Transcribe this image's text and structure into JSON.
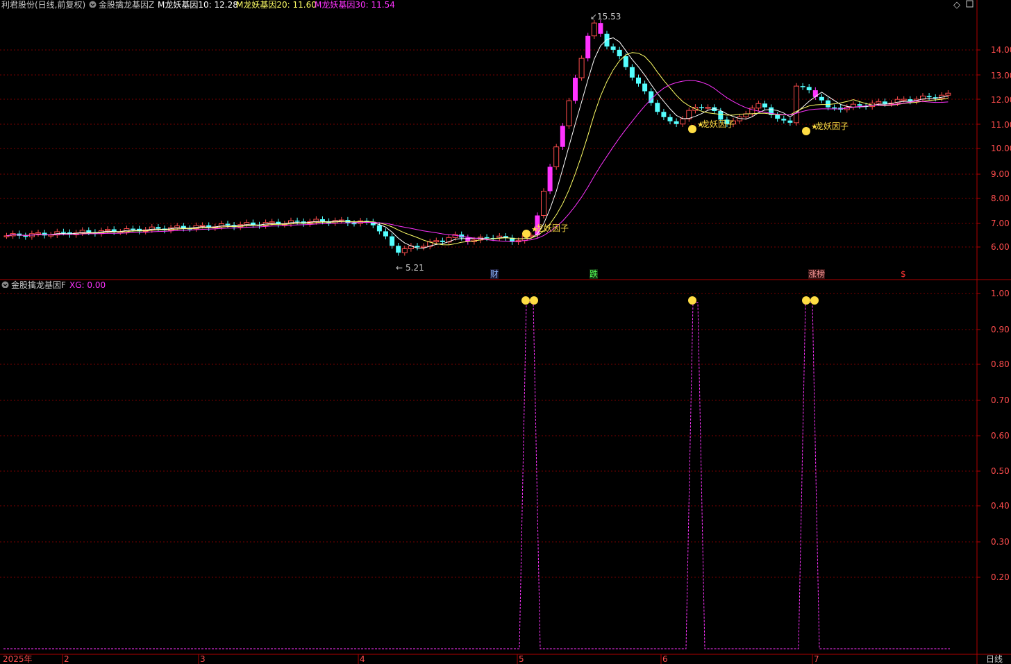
{
  "header": {
    "stock_title": "利君股份(日线,前复权)",
    "indicator_main": "金股擒龙基因Z",
    "ma10": "M龙妖基因10: 12.28",
    "ma20": "M龙妖基因20: 11.60",
    "ma30": "M龙妖基因30: 11.54"
  },
  "sub_header": {
    "indicator_sub": "金股擒龙基因F",
    "xg": "XG: 0.00"
  },
  "annotations": {
    "high_label": "15.53",
    "low_label": "5.21",
    "signal_label": "龙妖因子"
  },
  "events": {
    "cai": "财",
    "die": "跌",
    "zhangbang": "涨榜",
    "dollar": "$"
  },
  "y_axis_main": [
    "14.00",
    "13.00",
    "12.00",
    "11.00",
    "10.00",
    "9.00",
    "8.00",
    "7.00",
    "6.00"
  ],
  "y_axis_sub": [
    "1.00",
    "0.90",
    "0.80",
    "0.70",
    "0.60",
    "0.50",
    "0.40",
    "0.30",
    "0.20"
  ],
  "x_axis": {
    "year": "2025年",
    "months": [
      "2",
      "3",
      "4",
      "5",
      "6",
      "7"
    ],
    "period": "日线"
  },
  "colors": {
    "up": "#ff4d4d",
    "down": "#54ffff",
    "limit_up": "#ff33ff",
    "ma10": "#ffffff",
    "ma20": "#ffff66",
    "ma30": "#ff33ff",
    "grid": "#7a0000",
    "signal": "#ffdd44"
  },
  "chart_data": [
    {
      "type": "candlestick",
      "title": "金股擒龙基因Z",
      "ylim": [
        5.0,
        15.8
      ],
      "series": [
        {
          "name": "M龙妖基因10",
          "last": 12.28
        },
        {
          "name": "M龙妖基因20",
          "last": 11.6
        },
        {
          "name": "M龙妖基因30",
          "last": 11.54
        }
      ],
      "annotations": {
        "high": 15.53,
        "low": 5.21
      },
      "signals": [
        "龙妖因子",
        "龙妖因子",
        "龙妖因子"
      ]
    },
    {
      "type": "line",
      "title": "金股擒龙基因F",
      "series": [
        {
          "name": "XG",
          "last": 0.0
        }
      ],
      "ylim": [
        0.0,
        1.0
      ],
      "peaks": 5
    }
  ]
}
